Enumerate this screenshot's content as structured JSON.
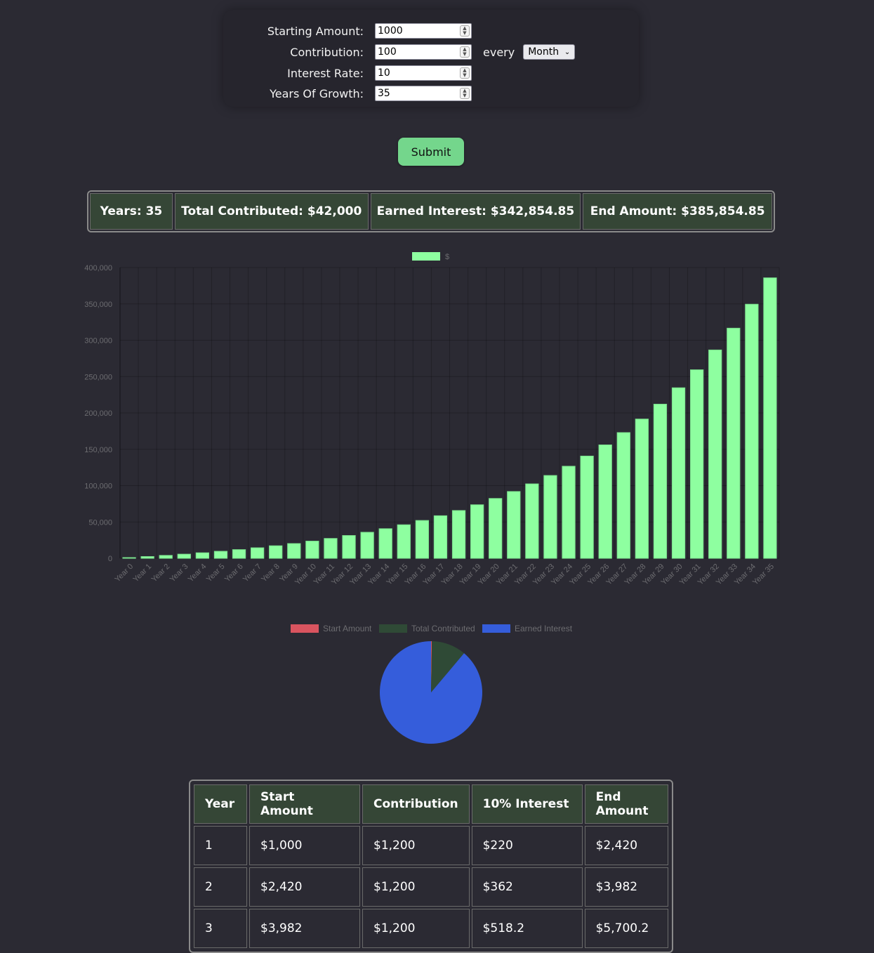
{
  "form": {
    "starting_label": "Starting Amount:",
    "starting_value": "1000",
    "contribution_label": "Contribution:",
    "contribution_value": "100",
    "every_label": "every",
    "frequency_value": "Month",
    "rate_label": "Interest Rate:",
    "rate_value": "10",
    "years_label": "Years Of Growth:",
    "years_value": "35",
    "submit_label": "Submit"
  },
  "summary": {
    "years": "Years: 35",
    "total_contributed": "Total Contributed: $42,000",
    "earned_interest": "Earned Interest: $342,854.85",
    "end_amount": "End Amount: $385,854.85"
  },
  "chart_data": [
    {
      "type": "bar",
      "categories": [
        "Year 0",
        "Year 1",
        "Year 2",
        "Year 3",
        "Year 4",
        "Year 5",
        "Year 6",
        "Year 7",
        "Year 8",
        "Year 9",
        "Year 10",
        "Year 11",
        "Year 12",
        "Year 13",
        "Year 14",
        "Year 15",
        "Year 16",
        "Year 17",
        "Year 18",
        "Year 19",
        "Year 20",
        "Year 21",
        "Year 22",
        "Year 23",
        "Year 24",
        "Year 25",
        "Year 26",
        "Year 27",
        "Year 28",
        "Year 29",
        "Year 30",
        "Year 31",
        "Year 32",
        "Year 33",
        "Year 34",
        "Year 35"
      ],
      "series": [
        {
          "name": "$",
          "color": "#8effa0",
          "values": [
            1000,
            2420,
            3982,
            5700.2,
            7590.22,
            9669.24,
            11956.17,
            14471.78,
            17238.96,
            20282.86,
            23631.14,
            27314.26,
            31365.68,
            35822.25,
            40724.47,
            46116.92,
            52048.61,
            58573.47,
            65750.82,
            73645.9,
            82330.49,
            91883.54,
            102391.89,
            113951.08,
            126666.19,
            140652.81,
            156038.09,
            172961.9,
            191578.09,
            212055.9,
            234581.49,
            259359.64,
            286615.6,
            316597.16,
            349576.88,
            385854.57
          ]
        }
      ],
      "ylim": [
        0,
        400000
      ],
      "yticks": [
        "0",
        "50,000",
        "100,000",
        "150,000",
        "200,000",
        "250,000",
        "300,000",
        "350,000",
        "400,000"
      ],
      "legend": "top",
      "grid": true
    },
    {
      "type": "pie",
      "categories": [
        "Start Amount",
        "Total Contributed",
        "Earned Interest"
      ],
      "values": [
        1000,
        42000,
        342854.85
      ],
      "colors": [
        "#d9545f",
        "#2f4a36",
        "#355ddb"
      ],
      "legend": "top"
    }
  ],
  "table": {
    "headers": [
      "Year",
      "Start Amount",
      "Contribution",
      "10% Interest",
      "End Amount"
    ],
    "rows": [
      [
        "1",
        "$1,000",
        "$1,200",
        "$220",
        "$2,420"
      ],
      [
        "2",
        "$2,420",
        "$1,200",
        "$362",
        "$3,982"
      ],
      [
        "3",
        "$3,982",
        "$1,200",
        "$518.2",
        "$5,700.2"
      ]
    ]
  }
}
